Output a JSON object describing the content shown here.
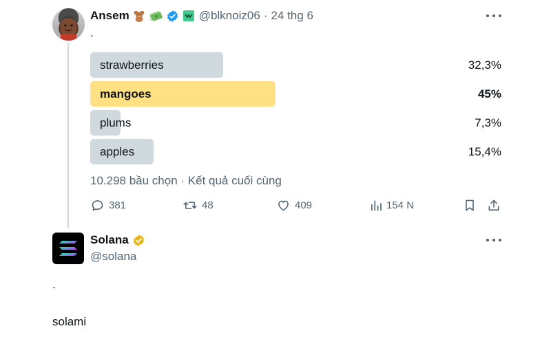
{
  "tweet1": {
    "author_name": "Ansem",
    "author_emojis": [
      "teddy-bear-emoji",
      "money-emoji",
      "verified-badge-icon",
      "green-square-emoji"
    ],
    "handle": "@blknoiz06",
    "separator": "·",
    "date": "24 thg 6",
    "text": ".",
    "poll": {
      "options": [
        {
          "label": "strawberries",
          "percent_text": "32,3%",
          "percent": 32.3,
          "winner": false
        },
        {
          "label": "mangoes",
          "percent_text": "45%",
          "percent": 45,
          "winner": true
        },
        {
          "label": "plums",
          "percent_text": "7,3%",
          "percent": 7.3,
          "winner": false
        },
        {
          "label": "apples",
          "percent_text": "15,4%",
          "percent": 15.4,
          "winner": false
        }
      ],
      "meta": "10.298 bầu chọn · Kết quả cuối cùng"
    },
    "actions": {
      "replies": "381",
      "reposts": "48",
      "likes": "409",
      "views": "154 N"
    }
  },
  "tweet2": {
    "author_name": "Solana",
    "handle": "@solana",
    "line1": ".",
    "line2": "solami"
  },
  "colors": {
    "winner_bar": "#ffe083",
    "loser_bar": "#cfd9de",
    "secondary_text": "#536471",
    "verified_blue": "#1d9bf0",
    "verified_gold": "#e2b719"
  }
}
